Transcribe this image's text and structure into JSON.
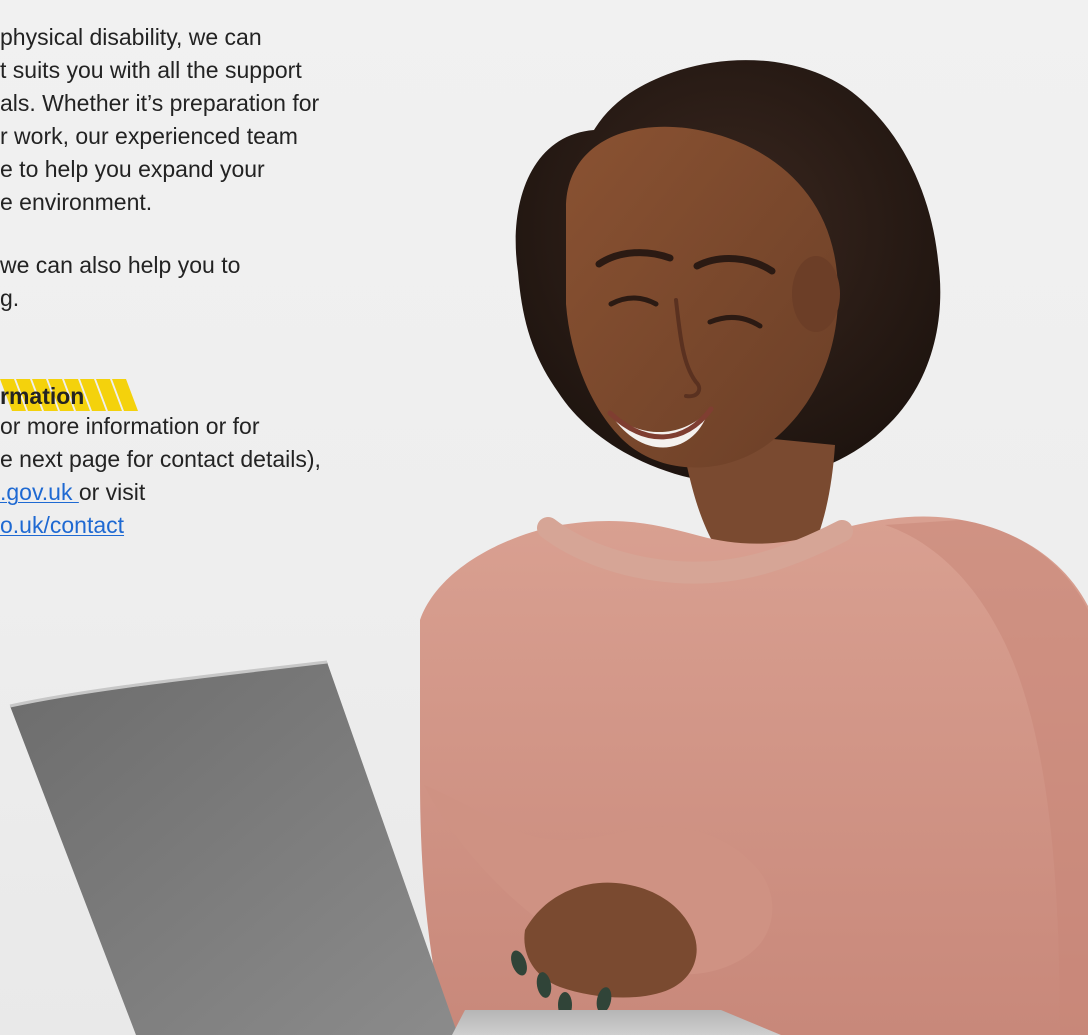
{
  "text": {
    "paragraph_1": [
      "physical disability, we can",
      "t suits you with all the support",
      "als. Whether it’s preparation for",
      "r work, our experienced team",
      "e to help you expand your",
      "e environment."
    ],
    "paragraph_2": [
      "we can also help you to",
      "g."
    ],
    "heading": "rmation",
    "contact": {
      "line_1": "or more information or for",
      "line_2": "e next page for contact details),",
      "line_3_link": ".gov.uk ",
      "line_3_suffix": "or visit",
      "line_4_link": "o.uk/contact "
    }
  },
  "colors": {
    "background": "#efefef",
    "text": "#232323",
    "link": "#1e69d2",
    "accent": "#f4d20c"
  }
}
